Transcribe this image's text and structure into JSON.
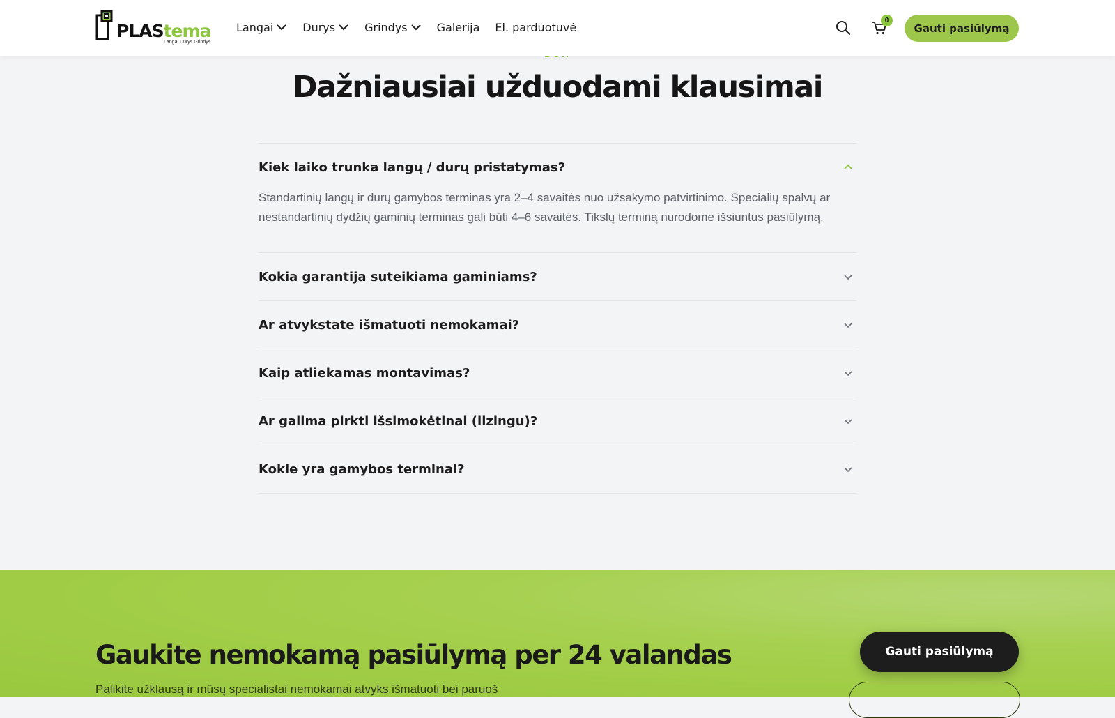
{
  "header": {
    "logo": {
      "brand_a": "PLAS",
      "brand_b": "tema",
      "tagline": "Langai Durys Grindys"
    },
    "nav": [
      {
        "label": "Langai",
        "has_dropdown": true
      },
      {
        "label": "Durys",
        "has_dropdown": true
      },
      {
        "label": "Grindys",
        "has_dropdown": true
      },
      {
        "label": "Galerija",
        "has_dropdown": false
      },
      {
        "label": "El. parduotuvė",
        "has_dropdown": false
      }
    ],
    "cart_count": "0",
    "cta_label": "Gauti pasiūlymą"
  },
  "faq": {
    "eyebrow": "DUK",
    "title": "Dažniausiai užduodami klausimai",
    "items": [
      {
        "question": "Kiek laiko trunka langų / durų pristatymas?",
        "answer": "Standartinių langų ir durų gamybos terminas yra 2–4 savaitės nuo užsakymo patvirtinimo. Specialių spalvų ar nestandartinių dydžių gaminių terminas gali būti 4–6 savaitės. Tikslų terminą nurodome išsiuntus pasiūlymą.",
        "expanded": true
      },
      {
        "question": "Kokia garantija suteikiama gaminiams?",
        "expanded": false
      },
      {
        "question": "Ar atvykstate išmatuoti nemokamai?",
        "expanded": false
      },
      {
        "question": "Kaip atliekamas montavimas?",
        "expanded": false
      },
      {
        "question": "Ar galima pirkti išsimokėtinai (lizingu)?",
        "expanded": false
      },
      {
        "question": "Kokie yra gamybos terminai?",
        "expanded": false
      }
    ]
  },
  "cta_section": {
    "title": "Gaukite nemokamą pasiūlymą per 24 valandas",
    "subtitle": "Palikite užklausą ir mūsų specialistai nemokamai atvyks išmatuoti bei paruoš",
    "button_label": "Gauti pasiūlymą"
  },
  "colors": {
    "accent": "#8dc63f",
    "button_green": "#9dc74a",
    "dark": "#1d1d1d",
    "page_bg": "#f3f4f6"
  }
}
